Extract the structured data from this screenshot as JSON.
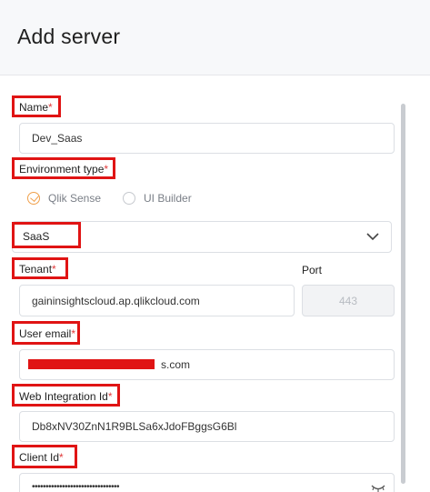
{
  "header": {
    "title": "Add server"
  },
  "form": {
    "name": {
      "label": "Name",
      "required": "*",
      "value": "Dev_Saas"
    },
    "environment_type": {
      "label": "Environment type",
      "required": "*",
      "options": [
        {
          "label": "Qlik Sense",
          "selected": true
        },
        {
          "label": "UI Builder",
          "selected": false
        }
      ]
    },
    "environment_select": {
      "value": "SaaS",
      "icon": "chevron-down-icon"
    },
    "tenant": {
      "label": "Tenant",
      "required": "*",
      "value": "gaininsightscloud.ap.qlikcloud.com"
    },
    "port": {
      "label": "Port",
      "value": "443"
    },
    "user_email": {
      "label": "User email",
      "required": "*",
      "value_suffix": "s.com"
    },
    "web_integration_id": {
      "label": "Web Integration Id",
      "required": "*",
      "value": "Db8xNV30ZnN1R9BLSa6xJdoFBggsG6Bl"
    },
    "client_id": {
      "label": "Client Id",
      "required": "*",
      "value": "••••••••••••••••••••••••••••••••",
      "icon": "eye-hidden-icon"
    }
  },
  "colors": {
    "highlight": "#e01414",
    "accent": "#f0a04b",
    "required": "#e03a3a"
  }
}
